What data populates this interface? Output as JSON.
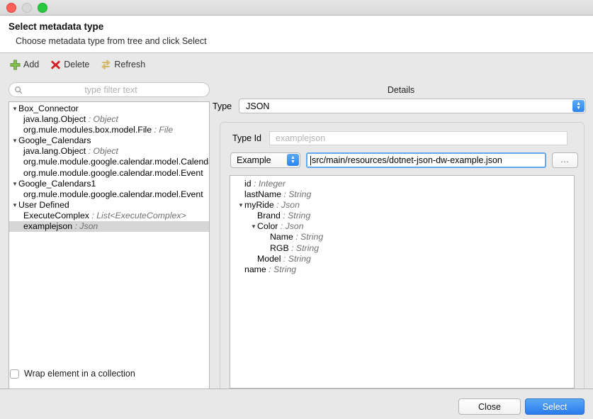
{
  "window": {
    "traffic_lights": [
      "close",
      "minimize",
      "zoom"
    ]
  },
  "header": {
    "title": "Select metadata type",
    "subtitle": "Choose metadata type from tree and click Select"
  },
  "toolbar": {
    "add_label": "Add",
    "delete_label": "Delete",
    "refresh_label": "Refresh"
  },
  "filter": {
    "placeholder": "type filter text",
    "value": ""
  },
  "tree": {
    "items": [
      {
        "label": "Box_Connector",
        "type": "",
        "level": 0,
        "expanded": true,
        "selected": false
      },
      {
        "label": "java.lang.Object",
        "type": "Object",
        "level": 1,
        "expanded": false,
        "selected": false
      },
      {
        "label": "org.mule.modules.box.model.File",
        "type": "File",
        "level": 1,
        "expanded": false,
        "selected": false
      },
      {
        "label": "Google_Calendars",
        "type": "",
        "level": 0,
        "expanded": true,
        "selected": false
      },
      {
        "label": "java.lang.Object",
        "type": "Object",
        "level": 1,
        "expanded": false,
        "selected": false
      },
      {
        "label": "org.mule.module.google.calendar.model.Calendar",
        "type": "",
        "level": 1,
        "expanded": false,
        "selected": false
      },
      {
        "label": "org.mule.module.google.calendar.model.Event",
        "type": "",
        "level": 1,
        "expanded": false,
        "selected": false
      },
      {
        "label": "Google_Calendars1",
        "type": "",
        "level": 0,
        "expanded": true,
        "selected": false
      },
      {
        "label": "org.mule.module.google.calendar.model.Event",
        "type": "",
        "level": 1,
        "expanded": false,
        "selected": false
      },
      {
        "label": "User Defined",
        "type": "",
        "level": 0,
        "expanded": true,
        "selected": false
      },
      {
        "label": "ExecuteComplex",
        "type": "List<ExecuteComplex>",
        "level": 1,
        "expanded": false,
        "selected": false
      },
      {
        "label": "examplejson",
        "type": "Json",
        "level": 1,
        "expanded": false,
        "selected": true
      }
    ]
  },
  "wrap_checkbox": {
    "label": "Wrap element in a collection",
    "checked": false
  },
  "details": {
    "title": "Details",
    "type_label": "Type",
    "type_value": "JSON",
    "type_id_label": "Type Id",
    "type_id_placeholder": "examplejson",
    "type_id_value": "",
    "source_mode": "Example",
    "path_value": "src/main/resources/dotnet-json-dw-example.json",
    "browse_label": "...",
    "schema": [
      {
        "label": "id",
        "type": "Integer",
        "level": 0,
        "expanded": false
      },
      {
        "label": "lastName",
        "type": "String",
        "level": 0,
        "expanded": false
      },
      {
        "label": "myRide",
        "type": "Json",
        "level": 0,
        "expanded": true
      },
      {
        "label": "Brand",
        "type": "String",
        "level": 1,
        "expanded": false
      },
      {
        "label": "Color",
        "type": "Json",
        "level": 1,
        "expanded": true
      },
      {
        "label": "Name",
        "type": "String",
        "level": 2,
        "expanded": false
      },
      {
        "label": "RGB",
        "type": "String",
        "level": 2,
        "expanded": false
      },
      {
        "label": "Model",
        "type": "String",
        "level": 1,
        "expanded": false
      },
      {
        "label": "name",
        "type": "String",
        "level": 0,
        "expanded": false
      }
    ]
  },
  "footer": {
    "close_label": "Close",
    "select_label": "Select"
  },
  "colors": {
    "accent_blue": "#2a7bec",
    "selection_gray": "#d6d6d6",
    "add_green": "#6aa84f",
    "delete_red": "#cc2222",
    "refresh_tan": "#d9bb6a"
  }
}
